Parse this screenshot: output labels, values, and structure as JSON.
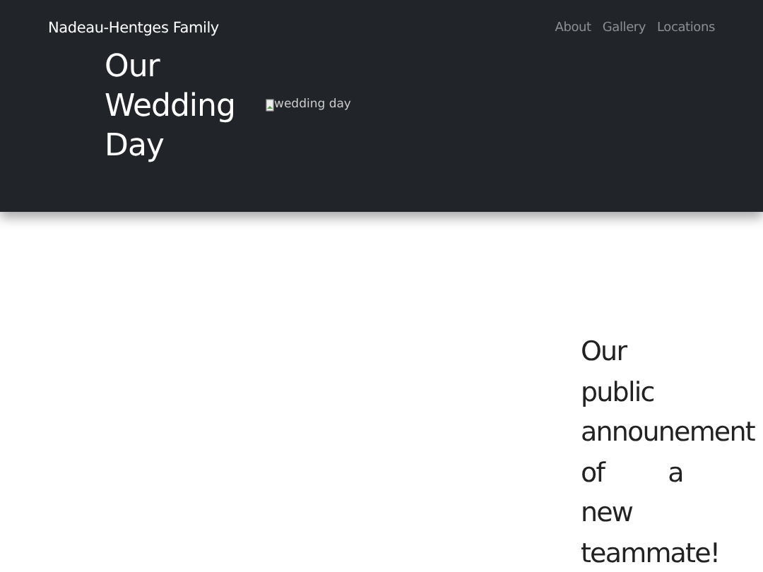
{
  "navbar": {
    "brand": "Nadeau-Hentges Family",
    "links": [
      {
        "label": "About"
      },
      {
        "label": "Gallery"
      },
      {
        "label": "Locations"
      }
    ]
  },
  "hero": {
    "title": "Our Wedding Day",
    "image_alt": "wedding day"
  },
  "announcement": {
    "title": "Our public announement of a new teammate!"
  }
}
